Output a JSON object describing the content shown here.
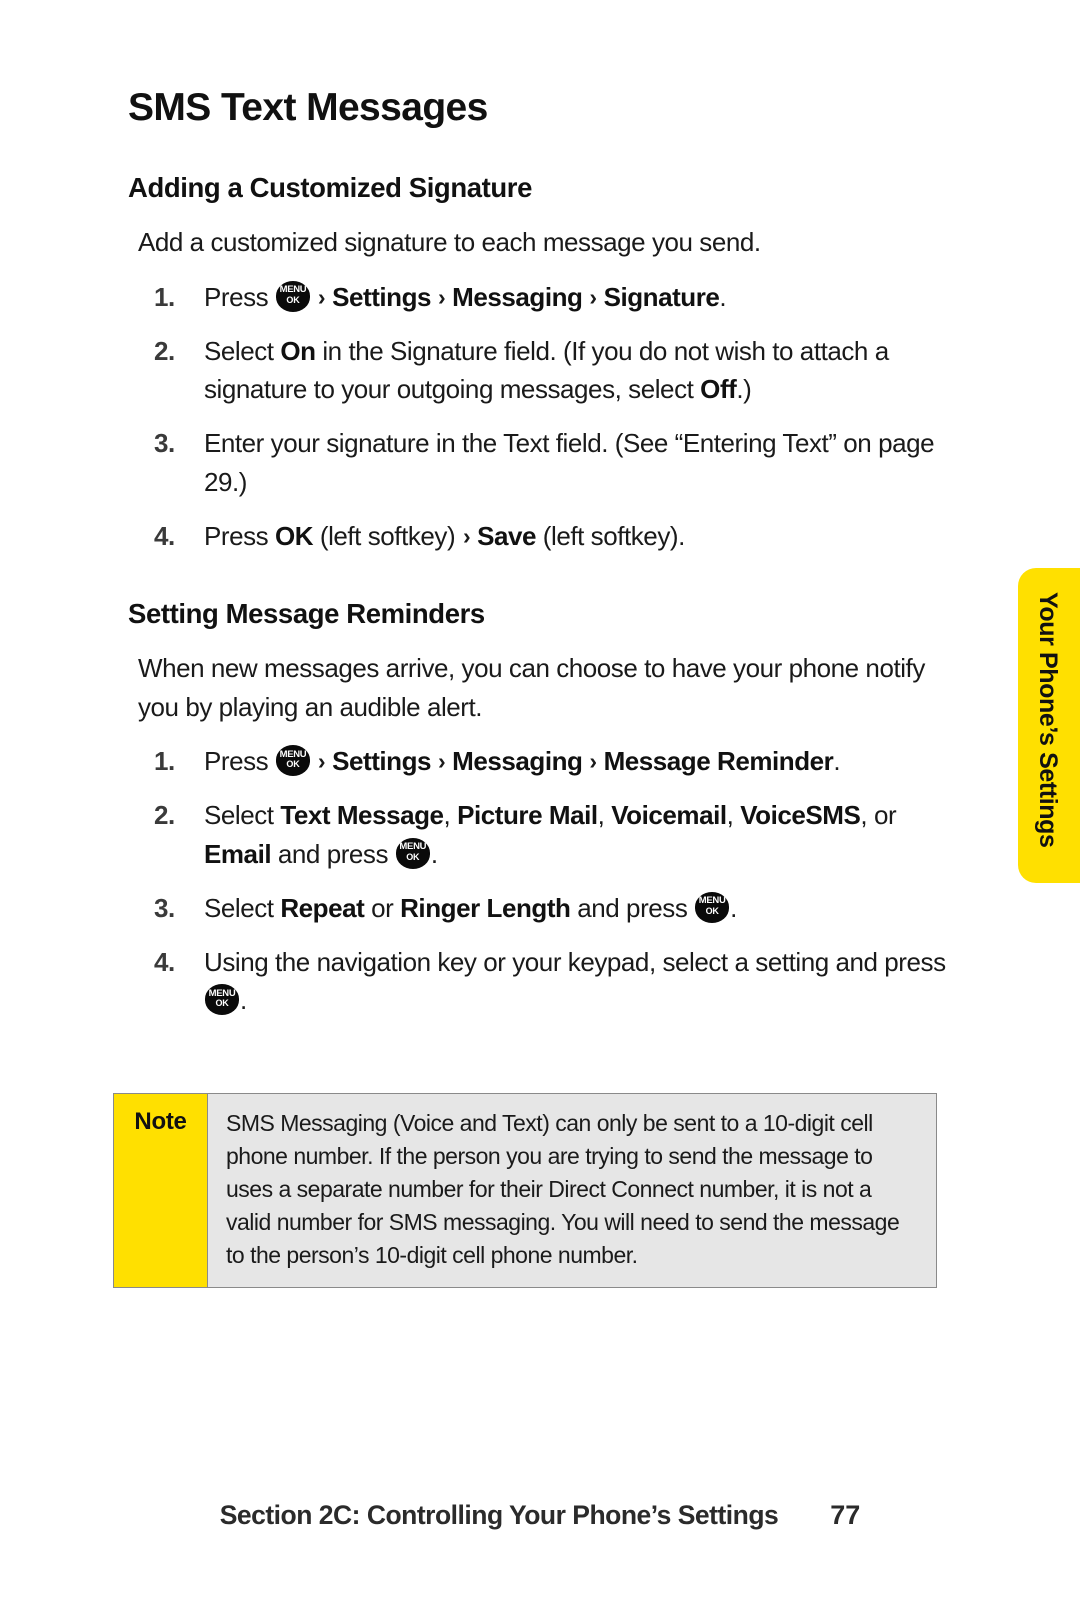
{
  "page": {
    "title": "SMS Text Messages",
    "number": "77",
    "footer_text": "Section 2C: Controlling Your Phone’s Settings",
    "side_tab_label": "Your Phone’s Settings"
  },
  "icons": {
    "menu_key_top": "MENU",
    "menu_key_bottom": "OK",
    "menu_key_name": "menu-ok-key-icon",
    "chevron": "›"
  },
  "colors": {
    "accent_yellow": "#FFE000",
    "note_background": "#E6E6E6",
    "note_border": "#8A8A8A",
    "text": "#1A1A1A"
  },
  "sections": [
    {
      "heading": "Adding a Customized Signature",
      "intro": "Add a customized signature to each message you send.",
      "steps": [
        {
          "number": "1.",
          "parts": [
            {
              "t": "text",
              "v": "Press "
            },
            {
              "t": "menukey"
            },
            {
              "t": "chev"
            },
            {
              "t": "bold",
              "v": "Settings"
            },
            {
              "t": "chev"
            },
            {
              "t": "bold",
              "v": "Messaging"
            },
            {
              "t": "chev"
            },
            {
              "t": "bold",
              "v": "Signature"
            },
            {
              "t": "text",
              "v": "."
            }
          ]
        },
        {
          "number": "2.",
          "parts": [
            {
              "t": "text",
              "v": "Select "
            },
            {
              "t": "bold",
              "v": "On"
            },
            {
              "t": "text",
              "v": " in the Signature field. (If you do not wish to attach a signature to your outgoing messages, select "
            },
            {
              "t": "bold",
              "v": "Off"
            },
            {
              "t": "text",
              "v": ".)"
            }
          ]
        },
        {
          "number": "3.",
          "parts": [
            {
              "t": "text",
              "v": "Enter your signature in the Text field. (See “Entering Text” on page 29.)"
            }
          ]
        },
        {
          "number": "4.",
          "parts": [
            {
              "t": "text",
              "v": "Press "
            },
            {
              "t": "bold",
              "v": "OK"
            },
            {
              "t": "text",
              "v": " (left softkey) "
            },
            {
              "t": "chev"
            },
            {
              "t": "bold",
              "v": "Save"
            },
            {
              "t": "text",
              "v": " (left softkey)."
            }
          ]
        }
      ]
    },
    {
      "heading": "Setting Message Reminders",
      "intro": "When new messages arrive, you can choose to have your phone notify you by playing an audible alert.",
      "steps": [
        {
          "number": "1.",
          "parts": [
            {
              "t": "text",
              "v": "Press "
            },
            {
              "t": "menukey"
            },
            {
              "t": "chev"
            },
            {
              "t": "bold",
              "v": "Settings"
            },
            {
              "t": "chev"
            },
            {
              "t": "bold",
              "v": "Messaging"
            },
            {
              "t": "chev"
            },
            {
              "t": "bold",
              "v": "Message Reminder"
            },
            {
              "t": "text",
              "v": "."
            }
          ]
        },
        {
          "number": "2.",
          "parts": [
            {
              "t": "text",
              "v": "Select "
            },
            {
              "t": "bold",
              "v": "Text Message"
            },
            {
              "t": "text",
              "v": ", "
            },
            {
              "t": "bold",
              "v": "Picture Mail"
            },
            {
              "t": "text",
              "v": ", "
            },
            {
              "t": "bold",
              "v": "Voicemail"
            },
            {
              "t": "text",
              "v": ", "
            },
            {
              "t": "bold",
              "v": "VoiceSMS"
            },
            {
              "t": "text",
              "v": ", or "
            },
            {
              "t": "bold",
              "v": "Email"
            },
            {
              "t": "text",
              "v": " and press "
            },
            {
              "t": "menukey"
            },
            {
              "t": "text",
              "v": "."
            }
          ]
        },
        {
          "number": "3.",
          "parts": [
            {
              "t": "text",
              "v": "Select "
            },
            {
              "t": "bold",
              "v": "Repeat"
            },
            {
              "t": "text",
              "v": " or "
            },
            {
              "t": "bold",
              "v": "Ringer Length"
            },
            {
              "t": "text",
              "v": " and press "
            },
            {
              "t": "menukey"
            },
            {
              "t": "text",
              "v": "."
            }
          ]
        },
        {
          "number": "4.",
          "parts": [
            {
              "t": "text",
              "v": "Using the navigation key or your keypad, select a setting and press "
            },
            {
              "t": "menukey"
            },
            {
              "t": "text",
              "v": "."
            }
          ]
        }
      ]
    }
  ],
  "note": {
    "label": "Note",
    "text": "SMS Messaging (Voice and Text) can only be sent to a 10-digit cell phone number. If the person you are trying to send the message to uses a separate number for their Direct Connect number, it is not a valid number for SMS messaging. You will need to send the message to the person’s 10-digit cell phone number."
  }
}
